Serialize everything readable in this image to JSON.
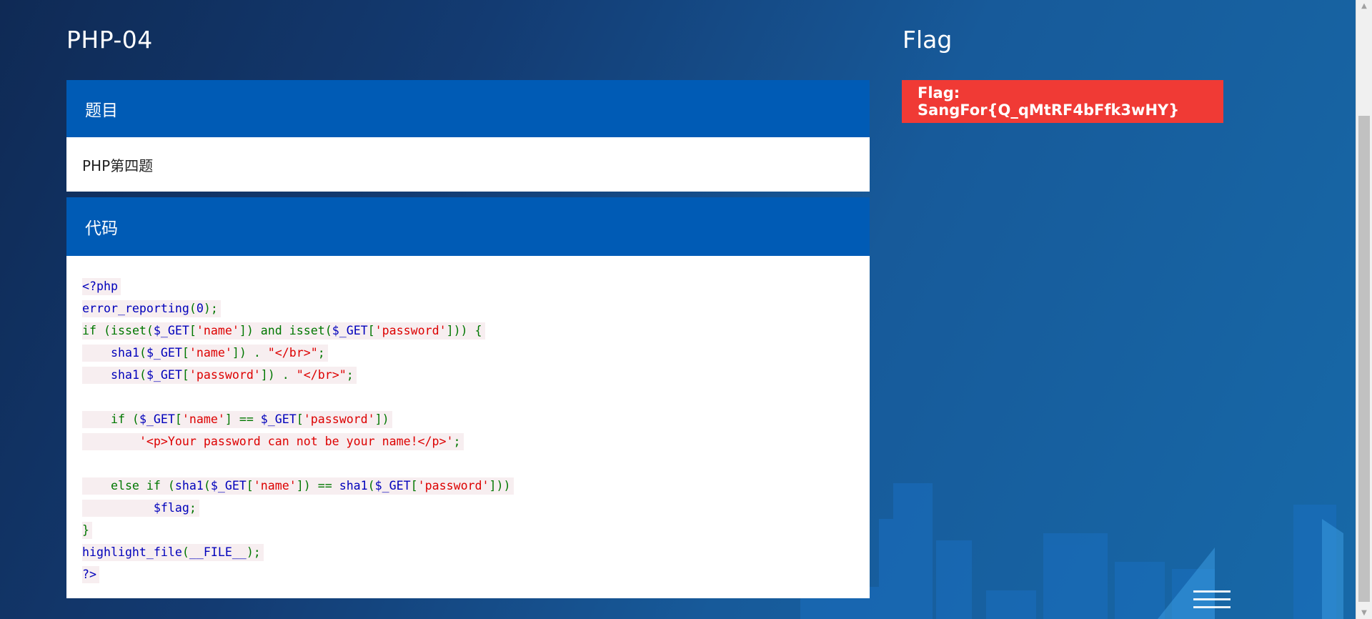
{
  "header": {
    "title": "PHP-04",
    "flag_title": "Flag"
  },
  "question_panel": {
    "heading": "题目",
    "body": "PHP第四题"
  },
  "code_panel": {
    "heading": "代码",
    "lines": [
      [
        {
          "t": "<?php",
          "c": "def"
        }
      ],
      [
        {
          "t": "error_reporting",
          "c": "def"
        },
        {
          "t": "(",
          "c": "kw"
        },
        {
          "t": "0",
          "c": "def"
        },
        {
          "t": ");",
          "c": "kw"
        }
      ],
      [
        {
          "t": "if (",
          "c": "kw"
        },
        {
          "t": "isset",
          "c": "kw"
        },
        {
          "t": "(",
          "c": "kw"
        },
        {
          "t": "$_GET",
          "c": "def"
        },
        {
          "t": "[",
          "c": "kw"
        },
        {
          "t": "'name'",
          "c": "str"
        },
        {
          "t": "]) and ",
          "c": "kw"
        },
        {
          "t": "isset",
          "c": "kw"
        },
        {
          "t": "(",
          "c": "kw"
        },
        {
          "t": "$_GET",
          "c": "def"
        },
        {
          "t": "[",
          "c": "kw"
        },
        {
          "t": "'password'",
          "c": "str"
        },
        {
          "t": "])) {",
          "c": "kw"
        }
      ],
      [
        {
          "t": "    ",
          "c": "kw"
        },
        {
          "t": "sha1",
          "c": "def"
        },
        {
          "t": "(",
          "c": "kw"
        },
        {
          "t": "$_GET",
          "c": "def"
        },
        {
          "t": "[",
          "c": "kw"
        },
        {
          "t": "'name'",
          "c": "str"
        },
        {
          "t": "]) . ",
          "c": "kw"
        },
        {
          "t": "\"</br>\"",
          "c": "str"
        },
        {
          "t": ";",
          "c": "kw"
        }
      ],
      [
        {
          "t": "    ",
          "c": "kw"
        },
        {
          "t": "sha1",
          "c": "def"
        },
        {
          "t": "(",
          "c": "kw"
        },
        {
          "t": "$_GET",
          "c": "def"
        },
        {
          "t": "[",
          "c": "kw"
        },
        {
          "t": "'password'",
          "c": "str"
        },
        {
          "t": "]) . ",
          "c": "kw"
        },
        {
          "t": "\"</br>\"",
          "c": "str"
        },
        {
          "t": ";",
          "c": "kw"
        }
      ],
      [],
      [
        {
          "t": "    if (",
          "c": "kw"
        },
        {
          "t": "$_GET",
          "c": "def"
        },
        {
          "t": "[",
          "c": "kw"
        },
        {
          "t": "'name'",
          "c": "str"
        },
        {
          "t": "] == ",
          "c": "kw"
        },
        {
          "t": "$_GET",
          "c": "def"
        },
        {
          "t": "[",
          "c": "kw"
        },
        {
          "t": "'password'",
          "c": "str"
        },
        {
          "t": "])",
          "c": "kw"
        }
      ],
      [
        {
          "t": "        ",
          "c": "kw"
        },
        {
          "t": "'<p>Your password can not be your name!</p>'",
          "c": "str"
        },
        {
          "t": ";",
          "c": "kw"
        }
      ],
      [],
      [
        {
          "t": "    else if (",
          "c": "kw"
        },
        {
          "t": "sha1",
          "c": "def"
        },
        {
          "t": "(",
          "c": "kw"
        },
        {
          "t": "$_GET",
          "c": "def"
        },
        {
          "t": "[",
          "c": "kw"
        },
        {
          "t": "'name'",
          "c": "str"
        },
        {
          "t": "]) == ",
          "c": "kw"
        },
        {
          "t": "sha1",
          "c": "def"
        },
        {
          "t": "(",
          "c": "kw"
        },
        {
          "t": "$_GET",
          "c": "def"
        },
        {
          "t": "[",
          "c": "kw"
        },
        {
          "t": "'password'",
          "c": "str"
        },
        {
          "t": "]))",
          "c": "kw"
        }
      ],
      [
        {
          "t": "          ",
          "c": "kw"
        },
        {
          "t": "$flag",
          "c": "def"
        },
        {
          "t": ";",
          "c": "kw"
        }
      ],
      [
        {
          "t": "}",
          "c": "kw"
        }
      ],
      [
        {
          "t": "highlight_file",
          "c": "def"
        },
        {
          "t": "(",
          "c": "kw"
        },
        {
          "t": "__FILE__",
          "c": "def"
        },
        {
          "t": ");",
          "c": "kw"
        }
      ],
      [
        {
          "t": "?>",
          "c": "def"
        }
      ]
    ]
  },
  "flag_panel": {
    "text": "Flag: SangFor{Q_qMtRF4bFfk3wHY}"
  },
  "colors": {
    "panel_header": "#005bb5",
    "flag_box": "#f03a35",
    "php_keyword": "#007700",
    "php_default": "#0000bb",
    "php_string": "#dd0000"
  },
  "icons": {
    "menu": "hamburger-menu-icon",
    "scroll_up": "arrow-up-icon",
    "scroll_down": "arrow-down-icon"
  }
}
